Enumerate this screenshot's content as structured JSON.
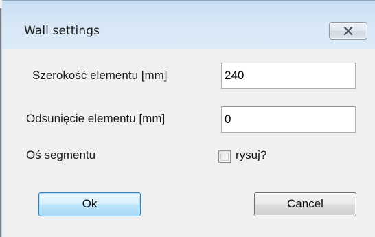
{
  "window": {
    "title": "Wall settings",
    "close_icon": "close-icon"
  },
  "form": {
    "width": {
      "label": "Szerokość elementu [mm]",
      "value": "240"
    },
    "offset": {
      "label": "Odsunięcie elementu [mm]",
      "value": "0"
    },
    "axis": {
      "label": "Oś segmentu",
      "checkbox_label": "rysuj?",
      "checked": false
    }
  },
  "buttons": {
    "ok_label": "Ok",
    "cancel_label": "Cancel"
  },
  "colors": {
    "titlebar": "#d7e7f6",
    "client": "#f0f0f0",
    "default_button_border": "#3c7fb1"
  }
}
